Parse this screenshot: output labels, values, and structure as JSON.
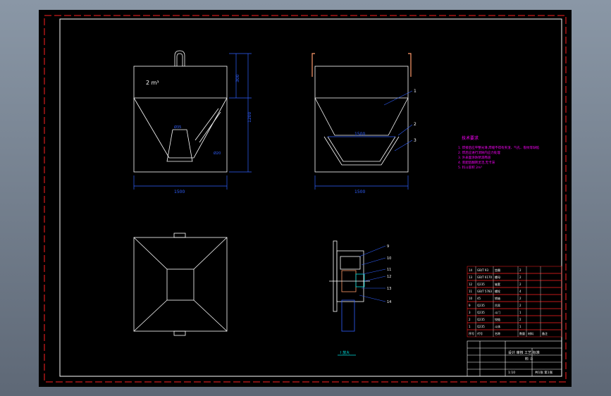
{
  "drawing": {
    "volume_label": "2 m³",
    "dimensions": {
      "front_width": "1500",
      "side_width": "1500",
      "upper_height": "300",
      "total_height": "1200",
      "inner_span": "1500",
      "diag_a": "Ø35",
      "diag_b": "Ø20"
    },
    "balloons": [
      "1",
      "2",
      "3",
      "9",
      "10",
      "11",
      "12",
      "13",
      "14"
    ],
    "detail_caption": "I 放大",
    "tech_notes": {
      "title": "技术要求",
      "lines": [
        "1. 焊接后应平整光滑,焊缝不得有夹渣、气孔、裂纹等缺陷",
        "2. 焊后应进行消除内应力处理",
        "3. 外表面涂防锈漆两道",
        "4. 装配后翻转灵活,无卡滞",
        "5. 料斗容积 2m³"
      ]
    },
    "bom_rows": [
      [
        "14",
        "GB/T 93",
        "垫圈",
        "2",
        "",
        ""
      ],
      [
        "13",
        "GB/T 6170",
        "螺母",
        "2",
        "",
        ""
      ],
      [
        "12",
        "Q235",
        "轴套",
        "2",
        "",
        ""
      ],
      [
        "11",
        "GB/T 5783",
        "螺栓",
        "4",
        "",
        ""
      ],
      [
        "10",
        "45",
        "销轴",
        "2",
        "",
        ""
      ],
      [
        "9",
        "Q235",
        "吊耳",
        "2",
        "",
        ""
      ],
      [
        "3",
        "Q235",
        "斗门",
        "1",
        "",
        ""
      ],
      [
        "2",
        "Q235",
        "铰链",
        "2",
        "",
        ""
      ],
      [
        "1",
        "Q235",
        "斗体",
        "1",
        "",
        ""
      ]
    ],
    "bom_header": [
      "序号",
      "代号",
      "名称",
      "数量",
      "材料",
      "备注"
    ],
    "title_block": {
      "name": "料 斗",
      "company": "设计 审核 工艺 标准",
      "scale": "1:10",
      "sheet": "共1张 第1张"
    }
  },
  "colors": {
    "border": "#ff2020",
    "frame_line": "#ffffff",
    "geometry": "#ffffff",
    "dimension": "#3060ff",
    "annotation": "#ff00ff",
    "detail": "#00e0e0",
    "handle": "#ff9a6a"
  }
}
